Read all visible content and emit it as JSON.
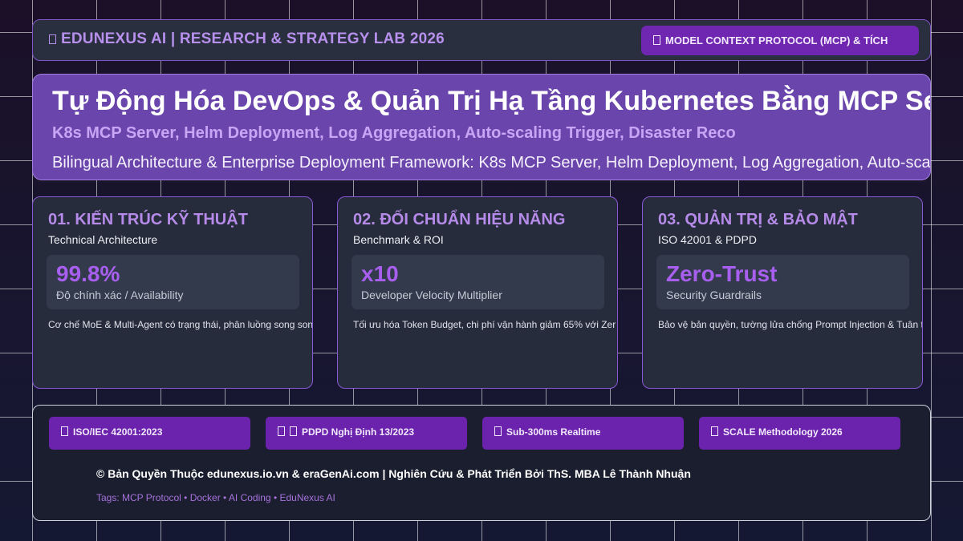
{
  "header": {
    "brand": "EDUNEXUS AI | RESEARCH & STRATEGY LAB 2026",
    "brand_icon": "unknown-glyph-icon",
    "pill": "MODEL CONTEXT PROTOCOL (MCP) & TÍCH",
    "pill_icon": "unknown-glyph-icon"
  },
  "hero": {
    "title": "Tự Động Hóa DevOps & Quản Trị Hạ Tầng Kubernetes Bằng MCP Serv",
    "subtitle": "K8s MCP Server, Helm Deployment, Log Aggregation, Auto-scaling Trigger, Disaster Reco",
    "description": "Bilingual Architecture & Enterprise Deployment Framework: K8s MCP Server, Helm Deployment, Log Aggregation, Auto-scaling"
  },
  "cards": [
    {
      "title": "01. KIẾN TRÚC KỸ THUẬT",
      "subtitle": "Technical Architecture",
      "metric_value": "99.8%",
      "metric_label": "Độ chính xác / Availability",
      "description": "Cơ chế MoE & Multi-Agent có trạng thái, phân luồng song son"
    },
    {
      "title": "02. ĐỐI CHUẨN HIỆU NĂNG",
      "subtitle": "Benchmark & ROI",
      "metric_value": "x10",
      "metric_label": "Developer Velocity Multiplier",
      "description": "Tối ưu hóa Token Budget, chi phí vận hành giảm 65% với Zer"
    },
    {
      "title": "03. QUẢN TRỊ & BẢO MẬT",
      "subtitle": "ISO 42001 & PDPD",
      "metric_value": "Zero-Trust",
      "metric_label": "Security Guardrails",
      "description": "Bảo vệ bản quyền, tường lửa chống Prompt Injection & Tuân thủ"
    }
  ],
  "footer": {
    "badges": [
      "ISO/IEC 42001:2023",
      "PDPD Nghị Định 13/2023",
      "Sub-300ms Realtime",
      "SCALE Methodology 2026"
    ],
    "copyright": "© Bản Quyền Thuộc edunexus.io.vn & eraGenAi.com | Nghiên Cứu & Phát Triển Bởi ThS. MBA Lê Thành Nhuận",
    "tags": "Tags: MCP Protocol • Docker • AI Coding • EduNexus AI"
  },
  "colors": {
    "accent_purple": "#6f26b0",
    "hero_bg": "#6a45ac",
    "card_bg": "#262c3b",
    "metric_text": "#a85fef"
  }
}
